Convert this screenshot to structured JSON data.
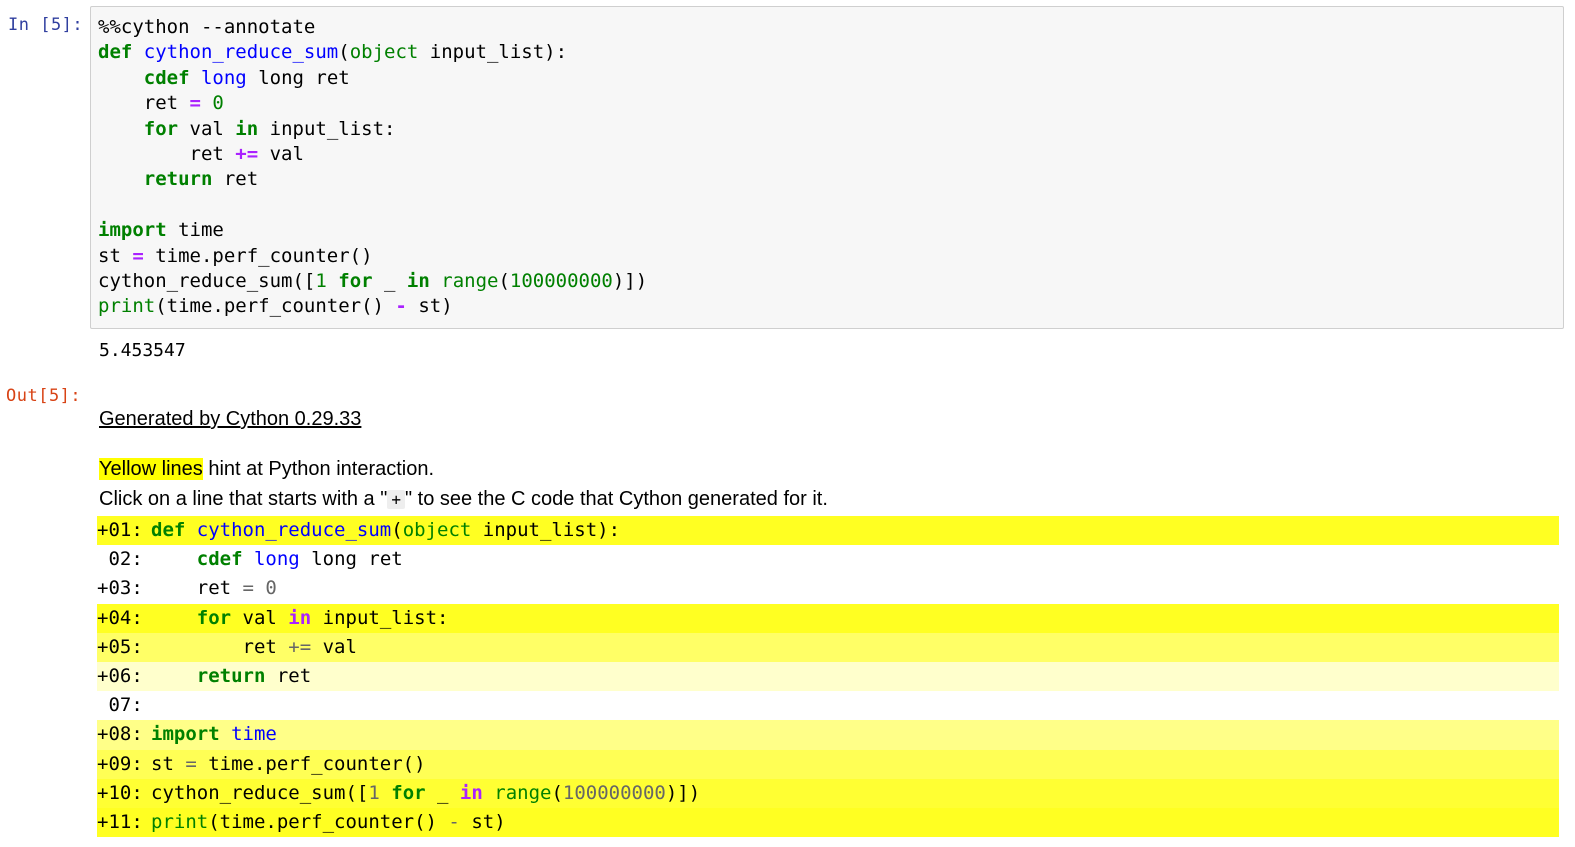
{
  "input_cell": {
    "prompt": "In [5]:",
    "code_lines": [
      "%%cython --annotate",
      "def cython_reduce_sum(object input_list):",
      "    cdef long long ret",
      "    ret = 0",
      "    for val in input_list:",
      "        ret += val",
      "    return ret",
      "",
      "import time",
      "st = time.perf_counter()",
      "cython_reduce_sum([1 for _ in range(100000000)])",
      "print(time.perf_counter() - st)"
    ]
  },
  "stdout": "5.453547",
  "output_cell": {
    "prompt": "Out[5]:",
    "generated_by": "Generated by Cython 0.29.33",
    "hint_highlight": "Yellow lines",
    "hint_rest": " hint at Python interaction.",
    "click_prefix": "Click on a line that starts with a \"",
    "click_plus": "+",
    "click_suffix": "\" to see the C code that Cython generated for it.",
    "annotated_lines": [
      {
        "number": "+01:",
        "code": "def cython_reduce_sum(object input_list):",
        "bg": "#ffff22"
      },
      {
        "number": " 02:",
        "code": "    cdef long long ret",
        "bg": "#ffffff"
      },
      {
        "number": "+03:",
        "code": "    ret = 0",
        "bg": "#ffffff"
      },
      {
        "number": "+04:",
        "code": "    for val in input_list:",
        "bg": "#ffff22"
      },
      {
        "number": "+05:",
        "code": "        ret += val",
        "bg": "#ffff66"
      },
      {
        "number": "+06:",
        "code": "    return ret",
        "bg": "#ffffcc"
      },
      {
        "number": " 07:",
        "code": "",
        "bg": "#ffffff"
      },
      {
        "number": "+08:",
        "code": "import time",
        "bg": "#ffff88"
      },
      {
        "number": "+09:",
        "code": "st = time.perf_counter()",
        "bg": "#ffff55"
      },
      {
        "number": "+10:",
        "code": "cython_reduce_sum([1 for _ in range(100000000)])",
        "bg": "#ffff33"
      },
      {
        "number": "+11:",
        "code": "print(time.perf_counter() - st)",
        "bg": "#ffff22"
      }
    ]
  },
  "colors": {
    "in_prompt": "#303f9f",
    "out_prompt": "#d84315",
    "cell_bg": "#f7f7f7",
    "cell_border": "#cfcfcf",
    "highlight": "#ffff00"
  }
}
